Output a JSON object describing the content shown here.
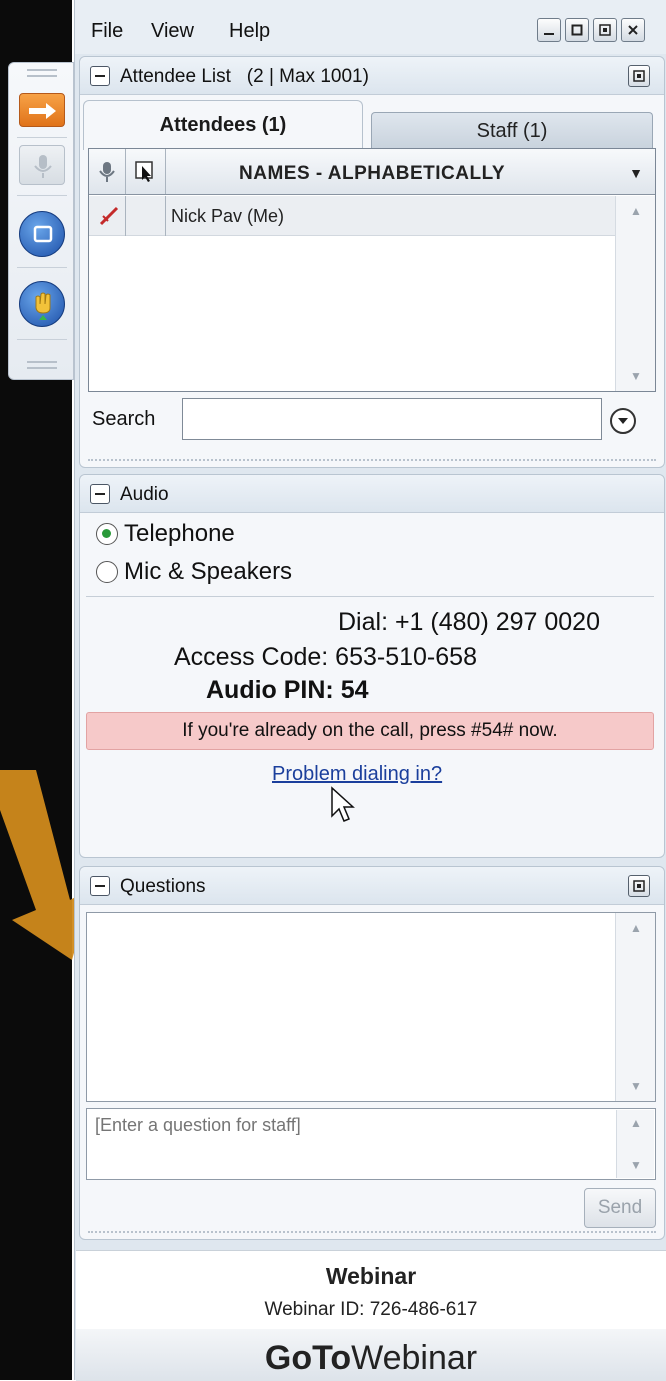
{
  "menu": {
    "file": "File",
    "view": "View",
    "help": "Help"
  },
  "attendee_list": {
    "title": "Attendee List",
    "count_text": "(2 | Max 1001)",
    "tabs": [
      {
        "label": "Attendees (1)"
      },
      {
        "label": "Staff (1)"
      }
    ],
    "sort_header": "NAMES - ALPHABETICALLY",
    "rows": [
      {
        "name": "Nick Pav (Me)"
      }
    ],
    "search_label": "Search",
    "search_value": ""
  },
  "audio": {
    "title": "Audio",
    "options": [
      {
        "label": "Telephone",
        "selected": true
      },
      {
        "label": "Mic & Speakers",
        "selected": false
      }
    ],
    "dial": "Dial: +1 (480) 297 0020",
    "access_code": "Access Code: 653-510-658",
    "audio_pin": "Audio PIN: 54",
    "notice": "If you're already on the call, press #54# now.",
    "problem_link": "Problem dialing in?"
  },
  "questions": {
    "title": "Questions",
    "input_placeholder": "[Enter a question for staff]",
    "send_label": "Send"
  },
  "footer": {
    "title": "Webinar",
    "webinar_id": "Webinar ID: 726-486-617",
    "logo_bold": "GoTo",
    "logo_light": "Webinar"
  },
  "colors": {
    "panel_bg": "#dfe7ef",
    "notice_bg": "#f6c9c9",
    "link": "#1b3f9c",
    "highlight_arrow": "#d08a1c"
  },
  "icons": {
    "toolbar": [
      "arrow-right-icon",
      "microphone-icon",
      "screen-icon",
      "raise-hand-icon"
    ],
    "window": [
      "minimize-icon",
      "maximize-icon",
      "restore-icon",
      "close-icon"
    ]
  }
}
